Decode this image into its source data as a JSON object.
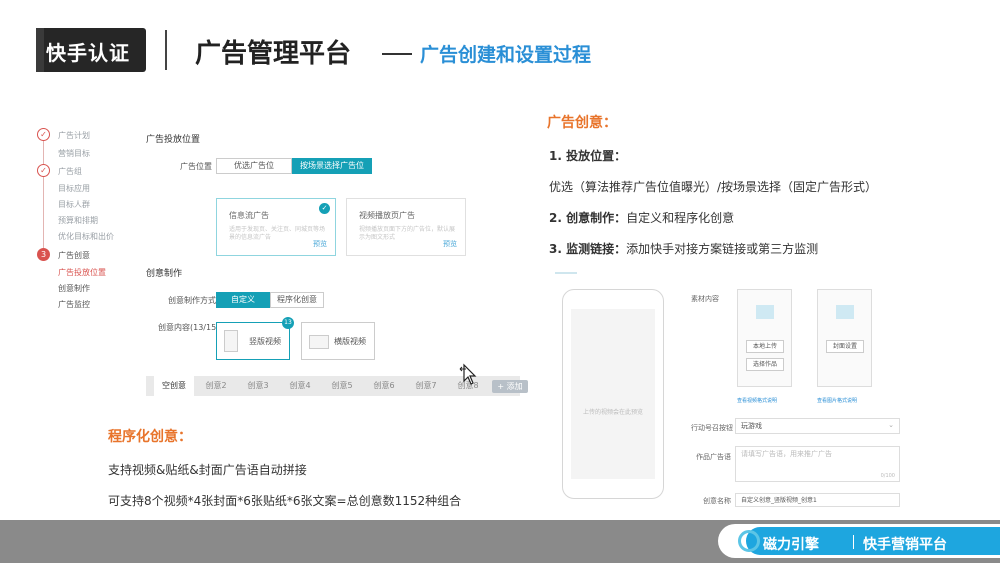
{
  "header": {
    "logo": "快手认证",
    "title": "广告管理平台",
    "subtitle": "广告创建和设置过程"
  },
  "left_ui": {
    "steps": [
      {
        "label": "广告计划",
        "state": "done"
      },
      {
        "label": "营销目标",
        "state": "sub"
      },
      {
        "label": "广告组",
        "state": "done"
      },
      {
        "label": "目标应用",
        "state": "sub"
      },
      {
        "label": "目标人群",
        "state": "sub"
      },
      {
        "label": "预算和排期",
        "state": "sub"
      },
      {
        "label": "优化目标和出价",
        "state": "sub"
      },
      {
        "label": "广告创意",
        "state": "current",
        "number": "3"
      },
      {
        "label": "广告投放位置",
        "state": "active"
      },
      {
        "label": "创意制作",
        "state": "sub"
      },
      {
        "label": "广告监控",
        "state": "sub"
      }
    ],
    "placement_section": "广告投放位置",
    "placement_label": "广告位置",
    "placement_options": [
      "优选广告位",
      "按场景选择广告位"
    ],
    "cards": [
      {
        "title": "信息流广告",
        "desc": "适用于发现页、关注页、同城页等场景的信息流广告",
        "link": "预览"
      },
      {
        "title": "视频播放页广告",
        "desc": "视频播放页面下方的广告位，默认展示为图文形式",
        "link": "预览"
      }
    ],
    "creative_section": "创意制作",
    "creative_mode_label": "创意制作方式",
    "creative_modes": [
      "自定义",
      "程序化创意"
    ],
    "creative_content_label": "创意内容(13/15)",
    "creative_types": [
      {
        "label": "竖版视频",
        "badge": "13"
      },
      {
        "label": "横版视频"
      }
    ],
    "tabs": [
      "空创意",
      "创意2",
      "创意3",
      "创意4",
      "创意5",
      "创意6",
      "创意7",
      "创意8"
    ],
    "tab_add": "+ 添加"
  },
  "right_text": {
    "title": "广告创意：",
    "item1_head": "1. 投放位置：",
    "item1_body": "优选（算法推荐广告位值曝光）/按场景选择（固定广告形式）",
    "item2_head": "2. 创意制作：",
    "item2_body": "自定义和程序化创意",
    "item3_head": "3. 监测链接：",
    "item3_body": "添加快手对接方案链接或第三方监测"
  },
  "right_ui": {
    "phone_hint": "上传的视频会在此预览",
    "material_label": "素材内容",
    "upload_local": "本地上传",
    "choose_work": "选择作品",
    "cover_setting": "封面设置",
    "video_spec_link": "查看视频格式说明",
    "image_spec_link": "查看图片格式说明",
    "action_label": "行动号召按钮",
    "action_value": "玩游戏",
    "caption_label": "作品广告语",
    "caption_placeholder": "请填写广告语，用来推广广告",
    "caption_count": "0/100",
    "name_label": "创意名称",
    "name_value": "自定义创意_竖版视频_创意1"
  },
  "bottom_text": {
    "title": "程序化创意：",
    "line1": "支持视频&贴纸&封面广告语自动拼接",
    "line2": "可支持8个视频*4张封面*6张贴纸*6张文案=总创意数1152种组合"
  },
  "footer": {
    "brand1": "磁力引擎",
    "brand2": "快手营销平台"
  },
  "colors": {
    "accent_orange": "#e8742b",
    "accent_teal": "#15a0b6",
    "accent_blue": "#2a8fd6",
    "step_red": "#d9534f"
  }
}
